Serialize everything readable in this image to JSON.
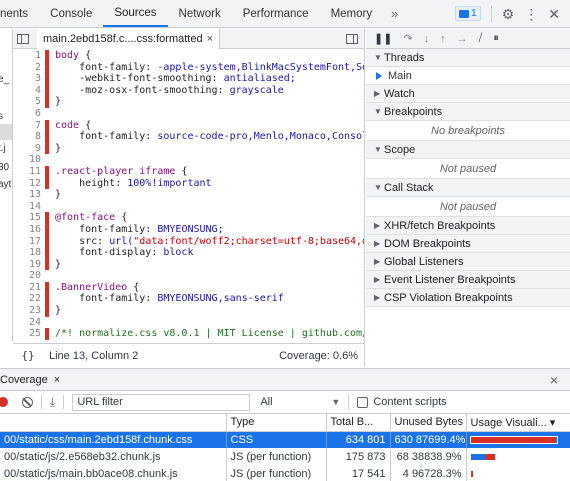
{
  "top_tabs": [
    {
      "label": "nents",
      "active": false
    },
    {
      "label": "Console",
      "active": false
    },
    {
      "label": "Sources",
      "active": true
    },
    {
      "label": "Network",
      "active": false
    },
    {
      "label": "Performance",
      "active": false
    },
    {
      "label": "Memory",
      "active": false
    }
  ],
  "more_tabs": "»",
  "message_count": "1",
  "navigator_fragments": [
    "e_",
    "s",
    "t.j",
    "30",
    "ayt"
  ],
  "editor": {
    "tab_label": "main.2ebd158f.c....css:formatted",
    "tab_close": "×",
    "lines": [
      {
        "n": "1",
        "mod": true,
        "parts": [
          {
            "c": "sel",
            "t": "body "
          },
          {
            "c": "plain",
            "t": "{"
          }
        ]
      },
      {
        "n": "2",
        "mod": true,
        "parts": [
          {
            "c": "prop",
            "t": "    font-family: "
          },
          {
            "c": "val",
            "t": "-apple-system,BlinkMacSystemFont,Se"
          }
        ]
      },
      {
        "n": "3",
        "mod": true,
        "parts": [
          {
            "c": "prop",
            "t": "    -webkit-font-smoothing: "
          },
          {
            "c": "val",
            "t": "antialiased;"
          }
        ]
      },
      {
        "n": "4",
        "mod": true,
        "parts": [
          {
            "c": "prop",
            "t": "    -moz-osx-font-smoothing: "
          },
          {
            "c": "val",
            "t": "grayscale"
          }
        ]
      },
      {
        "n": "5",
        "mod": true,
        "parts": [
          {
            "c": "plain",
            "t": "}"
          }
        ]
      },
      {
        "n": "6",
        "mod": false,
        "parts": []
      },
      {
        "n": "7",
        "mod": true,
        "parts": [
          {
            "c": "sel",
            "t": "code "
          },
          {
            "c": "plain",
            "t": "{"
          }
        ]
      },
      {
        "n": "8",
        "mod": true,
        "parts": [
          {
            "c": "prop",
            "t": "    font-family: "
          },
          {
            "c": "val",
            "t": "source-code-pro,Menlo,Monaco,Consol"
          }
        ]
      },
      {
        "n": "9",
        "mod": true,
        "parts": [
          {
            "c": "plain",
            "t": "}"
          }
        ]
      },
      {
        "n": "10",
        "mod": false,
        "parts": []
      },
      {
        "n": "11",
        "mod": true,
        "parts": [
          {
            "c": "sel",
            "t": ".react-player iframe "
          },
          {
            "c": "plain",
            "t": "{"
          }
        ]
      },
      {
        "n": "12",
        "mod": true,
        "parts": [
          {
            "c": "prop",
            "t": "    height: "
          },
          {
            "c": "val",
            "t": "100%!important"
          }
        ]
      },
      {
        "n": "13",
        "mod": false,
        "parts": [
          {
            "c": "plain",
            "t": "}"
          }
        ]
      },
      {
        "n": "14",
        "mod": false,
        "parts": []
      },
      {
        "n": "15",
        "mod": true,
        "parts": [
          {
            "c": "sel",
            "t": "@font-face "
          },
          {
            "c": "plain",
            "t": "{"
          }
        ]
      },
      {
        "n": "16",
        "mod": true,
        "parts": [
          {
            "c": "prop",
            "t": "    font-family: "
          },
          {
            "c": "val",
            "t": "BMYEONSUNG;"
          }
        ]
      },
      {
        "n": "17",
        "mod": true,
        "parts": [
          {
            "c": "prop",
            "t": "    src: "
          },
          {
            "c": "val",
            "t": "url("
          },
          {
            "c": "str",
            "t": "\"data:font/woff2;charset=utf-8;base64,d"
          }
        ]
      },
      {
        "n": "18",
        "mod": true,
        "parts": [
          {
            "c": "prop",
            "t": "    font-display: "
          },
          {
            "c": "val",
            "t": "block"
          }
        ]
      },
      {
        "n": "19",
        "mod": true,
        "parts": [
          {
            "c": "plain",
            "t": "}"
          }
        ]
      },
      {
        "n": "20",
        "mod": false,
        "parts": []
      },
      {
        "n": "21",
        "mod": true,
        "parts": [
          {
            "c": "sel",
            "t": ".BannerVideo "
          },
          {
            "c": "plain",
            "t": "{"
          }
        ]
      },
      {
        "n": "22",
        "mod": true,
        "parts": [
          {
            "c": "prop",
            "t": "    font-family: "
          },
          {
            "c": "val",
            "t": "BMYEONSUNG,sans-serif"
          }
        ]
      },
      {
        "n": "23",
        "mod": true,
        "parts": [
          {
            "c": "plain",
            "t": "}"
          }
        ]
      },
      {
        "n": "24",
        "mod": false,
        "parts": []
      },
      {
        "n": "25",
        "mod": true,
        "parts": [
          {
            "c": "cmt",
            "t": "/*! normalize.css v8.0.1 | MIT License | github.com/"
          }
        ]
      }
    ],
    "status_brace": "{}",
    "status_position": "Line 13, Column 2",
    "status_coverage": "Coverage: 0.6%"
  },
  "debugger": {
    "sections": [
      {
        "key": "threads",
        "label": "Threads",
        "expanded": true
      },
      {
        "key": "watch",
        "label": "Watch",
        "expanded": false
      },
      {
        "key": "breakpoints",
        "label": "Breakpoints",
        "expanded": true
      },
      {
        "key": "scope",
        "label": "Scope",
        "expanded": true
      },
      {
        "key": "callstack",
        "label": "Call Stack",
        "expanded": true
      },
      {
        "key": "xhr",
        "label": "XHR/fetch Breakpoints",
        "expanded": false
      },
      {
        "key": "dom",
        "label": "DOM Breakpoints",
        "expanded": false
      },
      {
        "key": "global",
        "label": "Global Listeners",
        "expanded": false
      },
      {
        "key": "event",
        "label": "Event Listener Breakpoints",
        "expanded": false
      },
      {
        "key": "csp",
        "label": "CSP Violation Breakpoints",
        "expanded": false
      }
    ],
    "thread_main": "Main",
    "no_breakpoints": "No breakpoints",
    "scope_paused": "Not paused",
    "callstack_paused": "Not paused"
  },
  "coverage": {
    "title": "Coverage",
    "title_close": "×",
    "close": "×",
    "filter_placeholder": "URL filter",
    "type_filter": "All",
    "content_scripts_label": "Content scripts",
    "columns": [
      "Type",
      "Total B...",
      "Unused Bytes",
      "Usage Visuali... ▾"
    ],
    "rows": [
      {
        "url": "00/static/css/main.2ebd158f.chunk.css",
        "type": "CSS",
        "total": "634 801",
        "unused": "630 876",
        "unused_pct": "99.4%",
        "used_fraction": 0.006,
        "bar_fraction": 1.0,
        "selected": true
      },
      {
        "url": "00/static/js/2.e568eb32.chunk.js",
        "type": "JS (per function)",
        "total": "175 873",
        "unused": "68 388",
        "unused_pct": "38.9%",
        "used_fraction": 0.611,
        "bar_fraction": 0.28,
        "selected": false
      },
      {
        "url": "00/static/js/main.bb0ace08.chunk.js",
        "type": "JS (per function)",
        "total": "17 541",
        "unused": "4 967",
        "unused_pct": "28.3%",
        "used_fraction": 0.717,
        "bar_fraction": 0.03,
        "selected": false
      }
    ]
  },
  "colors": {
    "accent": "#1a73e8",
    "modified_gutter": "#d93025",
    "unused_bar": "#d93025"
  }
}
